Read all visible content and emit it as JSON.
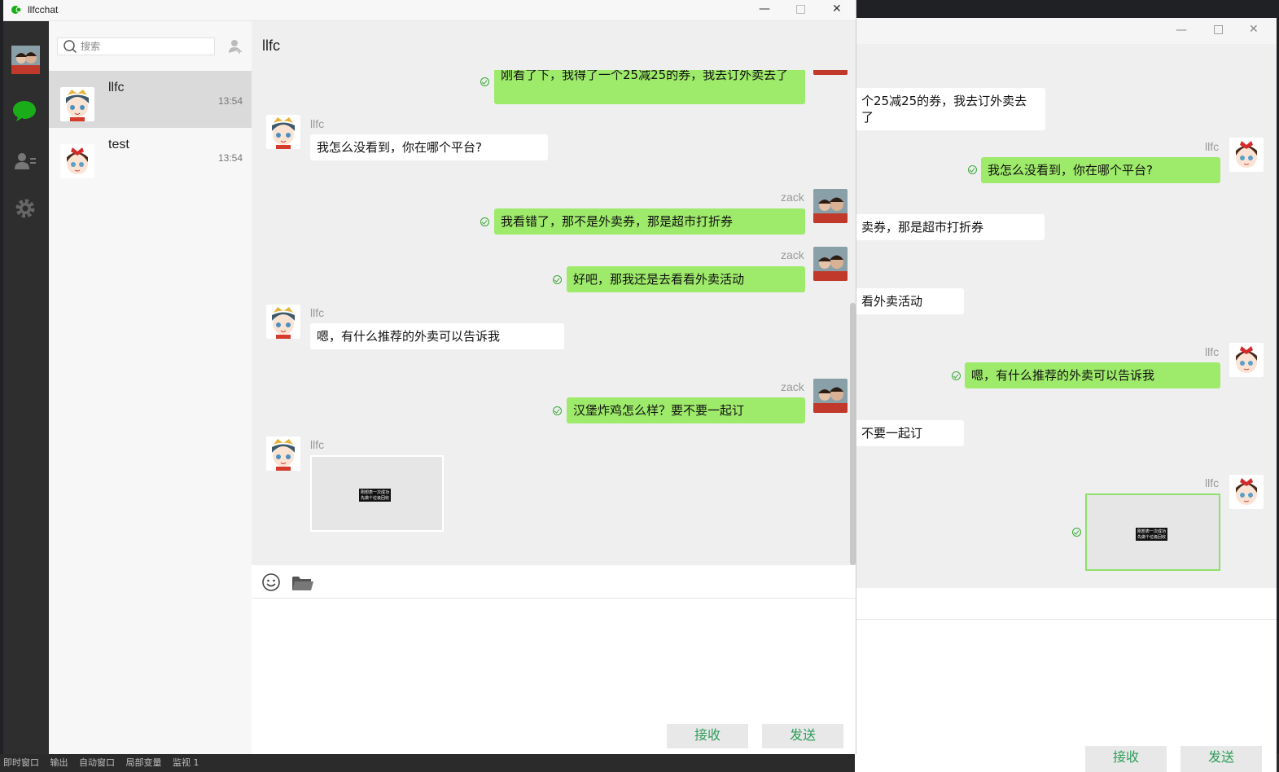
{
  "app": {
    "title": "llfcchat"
  },
  "window_controls": {
    "minimize": "—",
    "maximize": "□",
    "close": "✕"
  },
  "search": {
    "placeholder": "搜索"
  },
  "contacts": [
    {
      "name": "llfc",
      "time": "13:54",
      "selected": true
    },
    {
      "name": "test",
      "time": "13:54",
      "selected": false
    }
  ],
  "chat": {
    "title": "llfc",
    "messages": [
      {
        "sender": "",
        "side": "right",
        "text": "刚看了下，我得了一个25减25的券，我去订外卖去了"
      },
      {
        "sender": "llfc",
        "side": "left",
        "text": "我怎么没看到，你在哪个平台?"
      },
      {
        "sender": "zack",
        "side": "right",
        "text": "我看错了，那不是外卖券，那是超市打折券"
      },
      {
        "sender": "zack",
        "side": "right",
        "text": "好吧，那我还是去看看外卖活动"
      },
      {
        "sender": "llfc",
        "side": "left",
        "text": "嗯，有什么推荐的外卖可以告诉我"
      },
      {
        "sender": "zack",
        "side": "right",
        "text": "汉堡炸鸡怎么样？要不要一起订"
      },
      {
        "sender": "llfc",
        "side": "left",
        "type": "image",
        "caption": "刚想表一次成功\n先做个垃圾回收"
      }
    ]
  },
  "buttons": {
    "receive": "接收",
    "send": "发送"
  },
  "back_window": {
    "messages": [
      {
        "text": "个25减25的券，我去订外卖去了"
      },
      {
        "sender": "llfc",
        "text": "我怎么没看到，你在哪个平台?"
      },
      {
        "text": "卖券，那是超市打折券"
      },
      {
        "text": "看外卖活动"
      },
      {
        "sender": "llfc",
        "text": "嗯，有什么推荐的外卖可以告诉我"
      },
      {
        "text": "不要一起订"
      },
      {
        "sender": "llfc",
        "type": "image",
        "caption": "刚想表一次成功\n先做个垃圾回收"
      }
    ],
    "buttons": {
      "receive": "接收",
      "send": "发送"
    }
  },
  "ide_statusbar": {
    "items": [
      "即时窗口",
      "输出",
      "自动窗口",
      "局部变量",
      "监视 1"
    ]
  },
  "colors": {
    "green_bubble": "#9eea6a",
    "accent": "#2e9d5a",
    "sidebar": "#2e2e2e"
  }
}
